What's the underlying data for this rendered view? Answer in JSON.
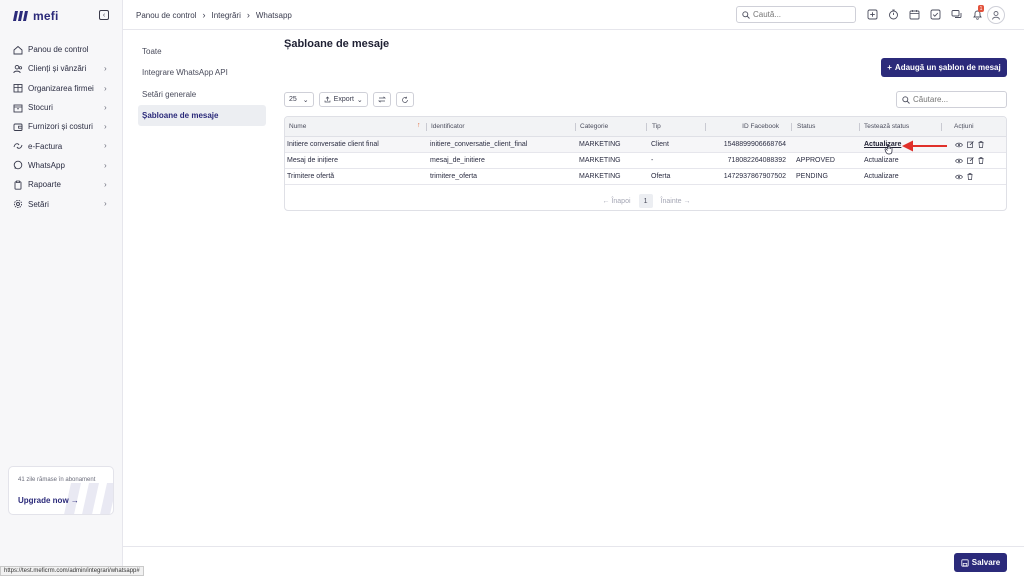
{
  "app": {
    "logo_text": "mefi"
  },
  "sidebar": {
    "items": [
      {
        "label": "Panou de control",
        "icon": "home-icon",
        "chevron": false
      },
      {
        "label": "Clienți și vânzări",
        "icon": "users-icon",
        "chevron": true
      },
      {
        "label": "Organizarea firmei",
        "icon": "building-icon",
        "chevron": true
      },
      {
        "label": "Stocuri",
        "icon": "box-icon",
        "chevron": true
      },
      {
        "label": "Furnizori și costuri",
        "icon": "wallet-icon",
        "chevron": true
      },
      {
        "label": "e-Factura",
        "icon": "efactura-icon",
        "chevron": true
      },
      {
        "label": "WhatsApp",
        "icon": "chat-icon",
        "chevron": true
      },
      {
        "label": "Rapoarte",
        "icon": "clipboard-icon",
        "chevron": true
      },
      {
        "label": "Setări",
        "icon": "gear-icon",
        "chevron": true
      }
    ],
    "upgrade": {
      "days_text": "41 zile rămase în abonament",
      "link_label": "Upgrade now"
    }
  },
  "header": {
    "breadcrumb": [
      "Panou de control",
      "Integrări",
      "Whatsapp"
    ],
    "search_placeholder": "Caută...",
    "notifications_count": "1"
  },
  "subnav": {
    "items": [
      "Toate",
      "Integrare WhatsApp API",
      "Setări generale",
      "Șabloane de mesaje"
    ],
    "active_index": 3
  },
  "main": {
    "title": "Șabloane de mesaje",
    "add_button": "Adaugă un șablon de mesaj",
    "page_size": "25",
    "export_label": "Export",
    "table_search_placeholder": "Căutare...",
    "columns": [
      "Nume",
      "Identificator",
      "Categorie",
      "Tip",
      "ID Facebook",
      "Status",
      "Testează status",
      "Acțiuni"
    ],
    "rows": [
      {
        "name": "Initiere conversatie client final",
        "identifier": "initiere_conversatie_client_final",
        "category": "MARKETING",
        "type": "Client",
        "facebook_id": "1548899906668764",
        "status": "",
        "test": "Actualizare"
      },
      {
        "name": "Mesaj de inițiere",
        "identifier": "mesaj_de_initiere",
        "category": "MARKETING",
        "type": "-",
        "facebook_id": "718082264088392",
        "status": "APPROVED",
        "test": "Actualizare"
      },
      {
        "name": "Trimitere ofertă",
        "identifier": "trimitere_oferta",
        "category": "MARKETING",
        "type": "Oferta",
        "facebook_id": "1472937867907502",
        "status": "PENDING",
        "test": "Actualizare"
      }
    ],
    "pagination": {
      "prev": "← Înapoi",
      "page": "1",
      "next": "Înainte →"
    }
  },
  "footer": {
    "save_label": "Salvare"
  },
  "statusbar": {
    "url": "https://test.meficrm.com/admin/integrari/whatsapp#"
  },
  "colors": {
    "brand": "#2b2a7a",
    "annotation_arrow": "#e0302a",
    "badge": "#e2523c"
  }
}
